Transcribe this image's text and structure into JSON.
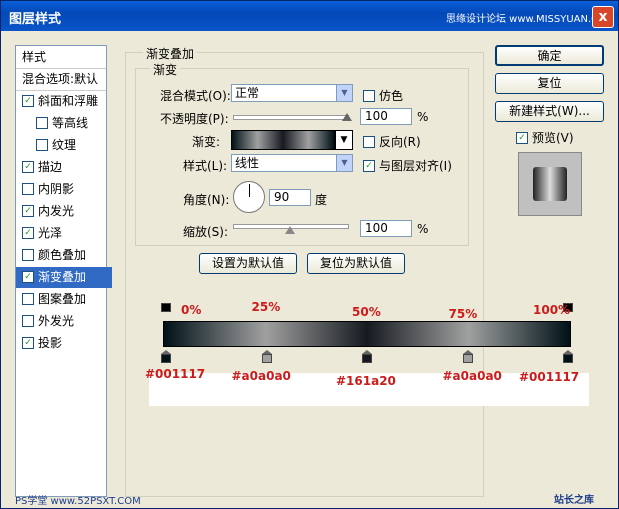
{
  "window": {
    "title": "图层样式",
    "watermark": "思缘设计论坛 www.MISSYUAN.COM",
    "close_glyph": "x"
  },
  "left_panel": {
    "header": "样式",
    "blend_options": "混合选项:默认",
    "items": [
      {
        "label": "斜面和浮雕",
        "checked": true,
        "indent": false
      },
      {
        "label": "等高线",
        "checked": false,
        "indent": true
      },
      {
        "label": "纹理",
        "checked": false,
        "indent": true
      },
      {
        "label": "描边",
        "checked": true,
        "indent": false
      },
      {
        "label": "内阴影",
        "checked": false,
        "indent": false
      },
      {
        "label": "内发光",
        "checked": true,
        "indent": false
      },
      {
        "label": "光泽",
        "checked": true,
        "indent": false
      },
      {
        "label": "颜色叠加",
        "checked": false,
        "indent": false
      },
      {
        "label": "渐变叠加",
        "checked": true,
        "indent": false,
        "selected": true
      },
      {
        "label": "图案叠加",
        "checked": false,
        "indent": false
      },
      {
        "label": "外发光",
        "checked": false,
        "indent": false
      },
      {
        "label": "投影",
        "checked": true,
        "indent": false
      }
    ]
  },
  "panel": {
    "outer_title": "渐变叠加",
    "inner_title": "渐变",
    "blend_mode_label": "混合模式(O):",
    "blend_mode_value": "正常",
    "dither_label": "仿色",
    "opacity_label": "不透明度(P):",
    "opacity_value": "100",
    "opacity_unit": "%",
    "gradient_label": "渐变:",
    "reverse_label": "反向(R)",
    "style_label": "样式(L):",
    "style_value": "线性",
    "align_label": "与图层对齐(I)",
    "angle_label": "角度(N):",
    "angle_value": "90",
    "angle_unit": "度",
    "scale_label": "缩放(S):",
    "scale_value": "100",
    "scale_unit": "%",
    "set_default_label": "设置为默认值",
    "reset_default_label": "复位为默认值",
    "opacity_level": 1.0,
    "scale_level": 0.5
  },
  "buttons": {
    "ok": "确定",
    "reset": "复位",
    "new_style": "新建样式(W)...",
    "preview_label": "预览(V)"
  },
  "gradient": {
    "percent_labels": [
      "0%",
      "25%",
      "50%",
      "75%",
      "100%"
    ],
    "color_labels": [
      "#001117",
      "#a0a0a0",
      "#161a20",
      "#a0a0a0",
      "#001117"
    ],
    "stops": [
      {
        "pos": 0,
        "color": "#001117"
      },
      {
        "pos": 25,
        "color": "#a0a0a0"
      },
      {
        "pos": 50,
        "color": "#161a20"
      },
      {
        "pos": 75,
        "color": "#a0a0a0"
      },
      {
        "pos": 100,
        "color": "#001117"
      }
    ]
  },
  "footer": {
    "left_watermark": "PS学堂  www.52PSXT.COM",
    "right_watermark": "站长之库"
  }
}
